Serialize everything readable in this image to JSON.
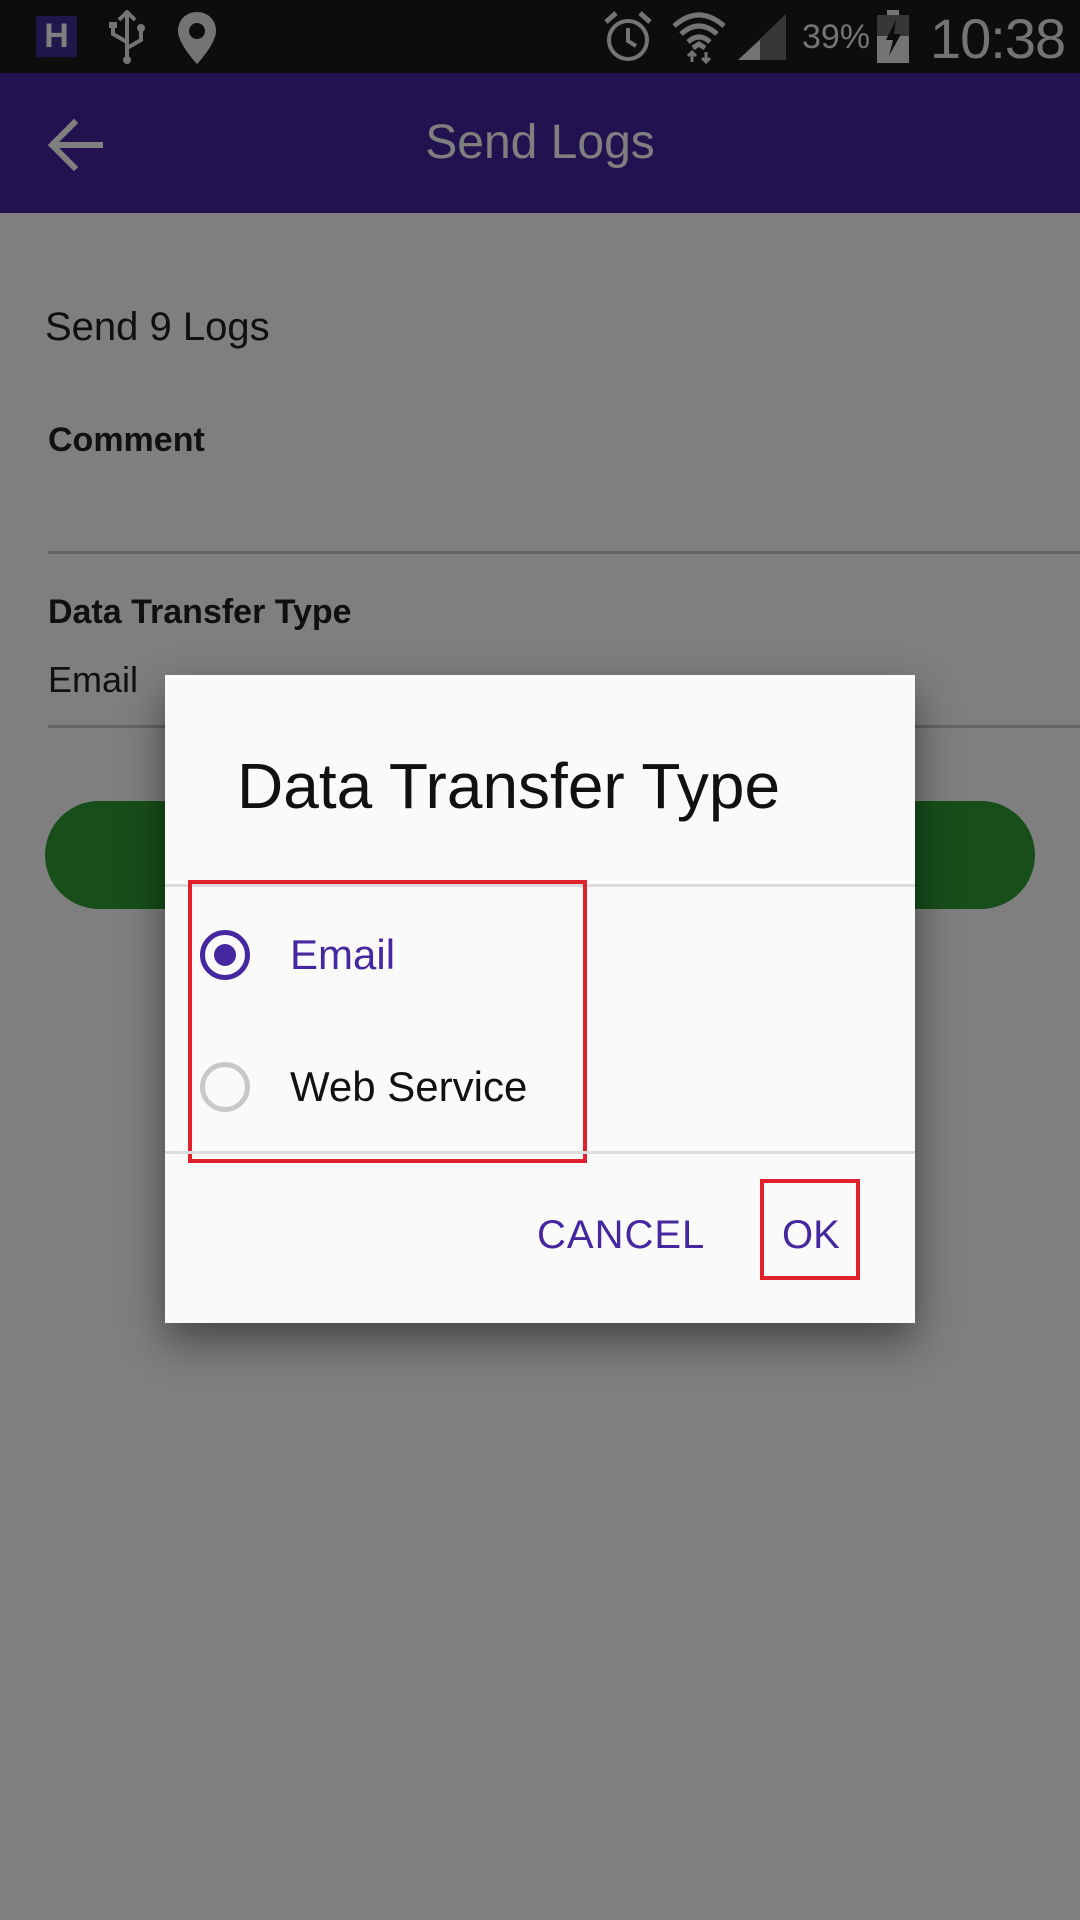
{
  "status_bar": {
    "app_icon_letter": "H",
    "battery_percent": "39%",
    "time": "10:38"
  },
  "app_bar": {
    "title": "Send Logs"
  },
  "form": {
    "send_count_label": "Send 9 Logs",
    "comment_label": "Comment",
    "comment_value": "",
    "data_transfer_type_label": "Data Transfer Type",
    "data_transfer_type_value": "Email"
  },
  "dialog": {
    "title": "Data Transfer Type",
    "options": [
      {
        "label": "Email",
        "selected": true
      },
      {
        "label": "Web Service",
        "selected": false
      }
    ],
    "cancel_label": "CANCEL",
    "ok_label": "OK"
  },
  "colors": {
    "primary": "#4527a0",
    "status_bar": "#1a1a1a",
    "send_button": "#2e9c34",
    "highlight": "#e0202a"
  }
}
